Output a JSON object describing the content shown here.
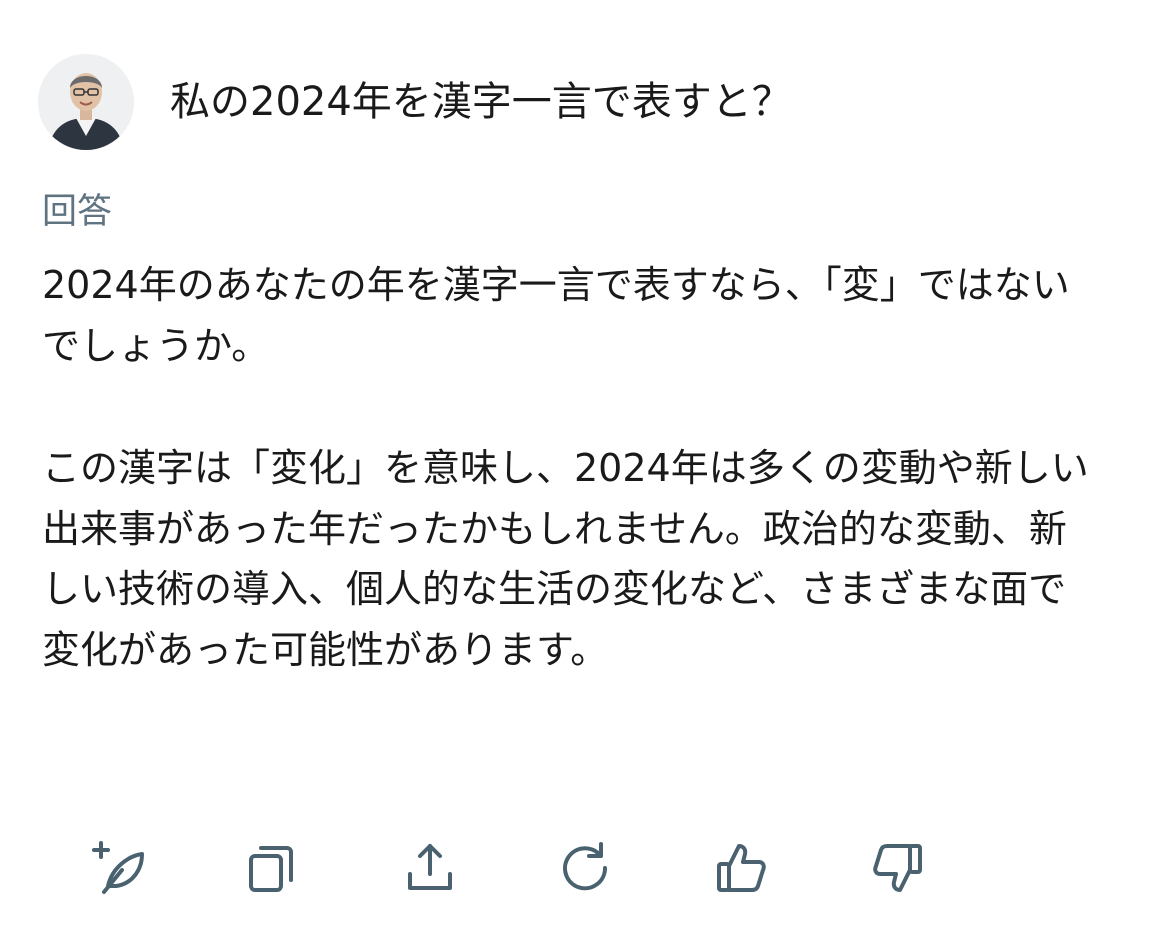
{
  "question": {
    "text": "私の2024年を漢字一言で表すと？"
  },
  "answer": {
    "label": "回答",
    "paragraphs": [
      "2024年のあなたの年を漢字一言で表すなら、「変」ではないでしょうか。",
      "この漢字は「変化」を意味し、2024年は多くの変動や新しい出来事があった年だったかもしれません。政治的な変動、新しい技術の導入、個人的な生活の変化など、さまざまな面で変化があった可能性があります。"
    ]
  },
  "actions": [
    {
      "icon": "add-feather-icon"
    },
    {
      "icon": "copy-icon"
    },
    {
      "icon": "share-icon"
    },
    {
      "icon": "regenerate-icon"
    },
    {
      "icon": "thumbs-up-icon"
    },
    {
      "icon": "thumbs-down-icon"
    }
  ],
  "colors": {
    "text": "#1a1a1a",
    "label": "#5f7380",
    "icon": "#4a6270",
    "background": "#ffffff"
  }
}
